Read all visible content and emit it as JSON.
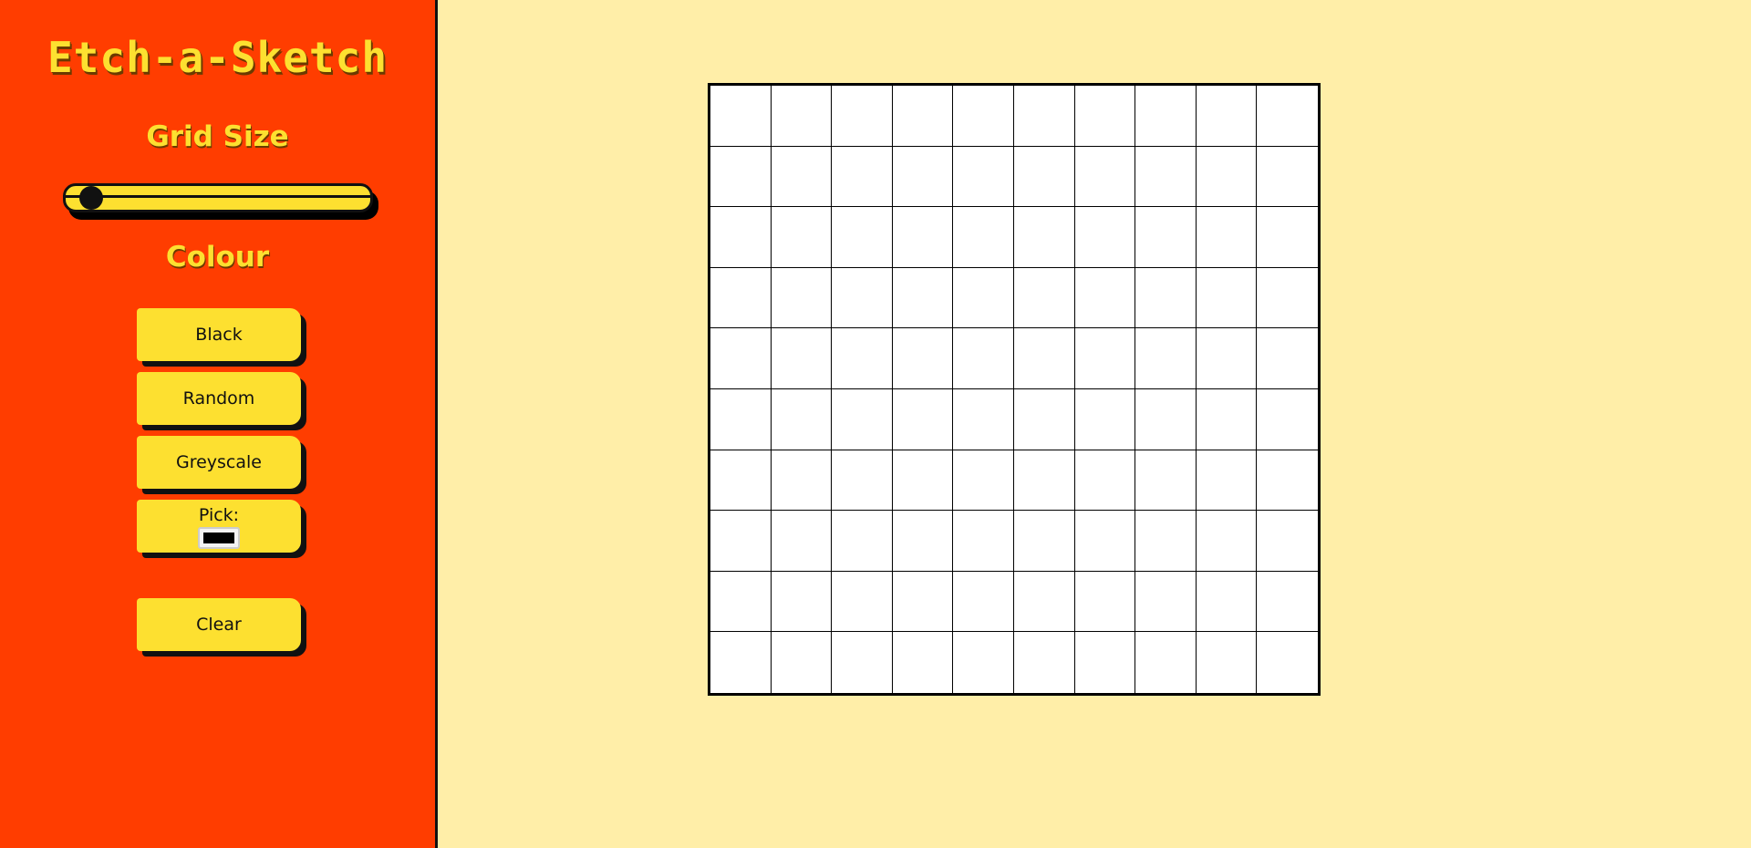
{
  "app": {
    "title": "Etch-a-Sketch"
  },
  "sidebar": {
    "grid_size_heading": "Grid Size",
    "colour_heading": "Colour",
    "slider": {
      "value": 10,
      "min": 10,
      "max": 100
    },
    "buttons": {
      "black": "Black",
      "random": "Random",
      "greyscale": "Greyscale",
      "pick": "Pick:",
      "clear": "Clear"
    },
    "picked_colour": "#000000"
  },
  "grid": {
    "rows": 10,
    "cols": 10,
    "cell_color": "#ffffff",
    "line_color": "#000000"
  },
  "colors": {
    "sidebar_bg": "#ff3d00",
    "accent_yellow": "#fde030",
    "main_bg": "#ffeea8"
  }
}
